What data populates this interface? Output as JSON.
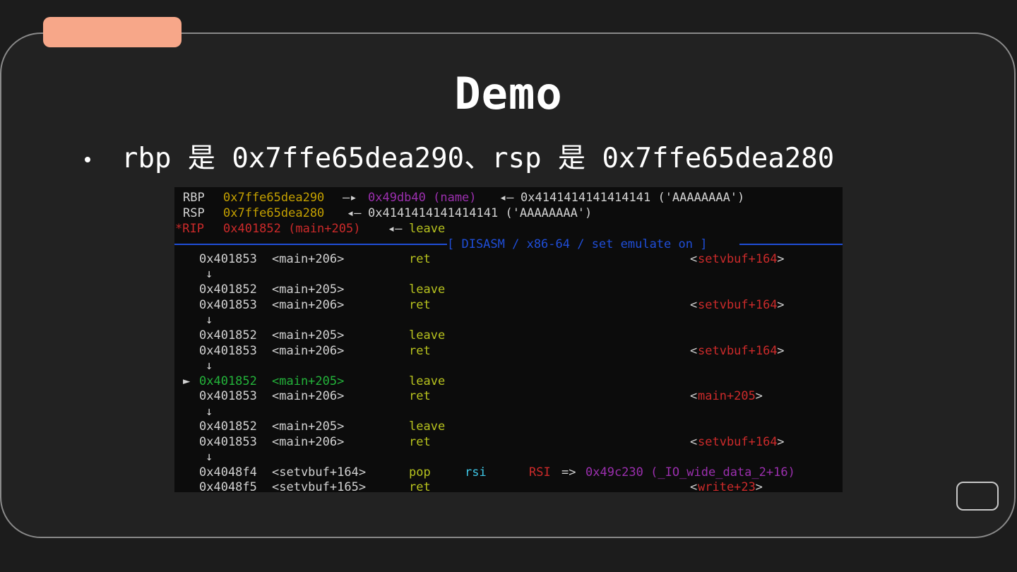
{
  "slide": {
    "title": "Demo",
    "bullet": "rbp 是 0x7ffe65dea290、rsp 是 0x7ffe65dea280"
  },
  "colors": {
    "tab_accent": "#f7a789",
    "card_bg": "#222222",
    "page_bg": "#1c1c1c",
    "term_bg": "#0c0c0c"
  },
  "terminal": {
    "registers": [
      {
        "name": "RBP",
        "value": "0x7ffe65dea290",
        "arrow1": "—▸",
        "pointee": "0x49db40 (name)",
        "arrow2": "◂—",
        "deref": "0x4141414141414141 ('AAAAAAAA')"
      },
      {
        "name": "RSP",
        "value": "0x7ffe65dea280",
        "arrow1": "◂—",
        "deref": "0x4141414141414141 ('AAAAAAAA')"
      },
      {
        "name": "*RIP",
        "value": "0x401852 (main+205)",
        "arrow1": "◂—",
        "deref": "leave"
      }
    ],
    "banner": "[ DISASM / x86-64 / set emulate on ]",
    "down_arrow": "↓",
    "current_marker": "►",
    "disasm": [
      {
        "addr": "0x401853",
        "sym": "<main+206>",
        "op": "ret",
        "target": "setvbuf+164"
      },
      {
        "addr": "0x401852",
        "sym": "<main+205>",
        "op": "leave"
      },
      {
        "addr": "0x401853",
        "sym": "<main+206>",
        "op": "ret",
        "target": "setvbuf+164"
      },
      {
        "addr": "0x401852",
        "sym": "<main+205>",
        "op": "leave"
      },
      {
        "addr": "0x401853",
        "sym": "<main+206>",
        "op": "ret",
        "target": "setvbuf+164"
      },
      {
        "addr": "0x401852",
        "sym": "<main+205>",
        "op": "leave",
        "current": true
      },
      {
        "addr": "0x401853",
        "sym": "<main+206>",
        "op": "ret",
        "target": "main+205"
      },
      {
        "addr": "0x401852",
        "sym": "<main+205>",
        "op": "leave"
      },
      {
        "addr": "0x401853",
        "sym": "<main+206>",
        "op": "ret",
        "target": "setvbuf+164"
      },
      {
        "addr": "0x4048f4",
        "sym": "<setvbuf+164>",
        "op": "pop",
        "operand": "rsi",
        "note_reg": "RSI",
        "note_arrow": "=>",
        "note_val": "0x49c230 (_IO_wide_data_2+16)"
      },
      {
        "addr": "0x4048f5",
        "sym": "<setvbuf+165>",
        "op": "ret",
        "target": "write+23"
      }
    ]
  }
}
